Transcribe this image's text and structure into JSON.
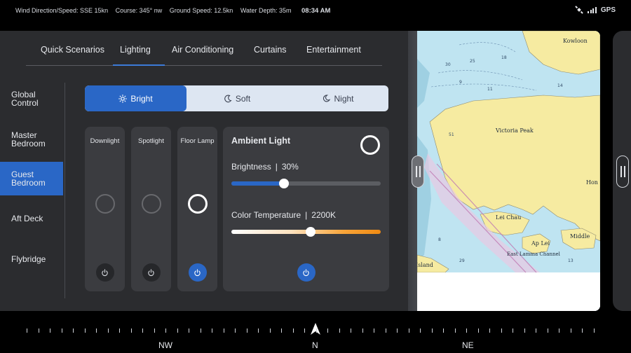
{
  "status": {
    "wind": "Wind Direction/Speed: SSE 15kn",
    "course": "Course: 345° nw",
    "ground_speed": "Ground Speed: 12.5kn",
    "water_depth": "Water Depth: 35m",
    "time": "08:34 AM",
    "gps_label": "GPS",
    "icons": [
      "satellite-icon",
      "signal-bars-icon"
    ]
  },
  "tabs": [
    {
      "label": "Quick Scenarios",
      "active": false
    },
    {
      "label": "Lighting",
      "active": true
    },
    {
      "label": "Air Conditioning",
      "active": false
    },
    {
      "label": "Curtains",
      "active": false
    },
    {
      "label": "Entertainment",
      "active": false
    }
  ],
  "sidebar": {
    "items": [
      {
        "label": "Global Control",
        "active": false
      },
      {
        "label": "Master Bedroom",
        "active": false
      },
      {
        "label": "Guest Bedroom",
        "active": true
      },
      {
        "label": "Aft Deck",
        "active": false
      },
      {
        "label": "Flybridge",
        "active": false
      }
    ]
  },
  "modes": [
    {
      "label": "Bright",
      "icon": "sun-icon",
      "active": true
    },
    {
      "label": "Soft",
      "icon": "moon-icon",
      "active": false
    },
    {
      "label": "Night",
      "icon": "night-icon",
      "active": false
    }
  ],
  "lamps": [
    {
      "label": "Downlight",
      "on": false
    },
    {
      "label": "Spotlight",
      "on": false
    },
    {
      "label": "Floor Lamp",
      "on": true
    }
  ],
  "ambient": {
    "title": "Ambient Light",
    "on": true,
    "brightness_label": "Brightness",
    "brightness_value": "30%",
    "brightness_fraction": 0.35,
    "color_temp_label": "Color Temperature",
    "color_temp_value": "2200K",
    "color_temp_fraction": 0.53
  },
  "map": {
    "labels": {
      "kowloon": "Kowloon",
      "victoria_peak": "Victoria Peak",
      "hong": "Hon",
      "lei_chau": "Lei Chau",
      "middle": "Middle",
      "island": "Island",
      "east_lamma": "East Lamma Channel",
      "ap_lei": "Ap Lei"
    }
  },
  "compass": {
    "labels": [
      "NW",
      "N",
      "NE"
    ]
  },
  "colors": {
    "accent": "#2a67c6",
    "panel": "#2b2c2f",
    "card": "#3b3c40",
    "land": "#f6eba1",
    "water": "#bfe4f1"
  }
}
